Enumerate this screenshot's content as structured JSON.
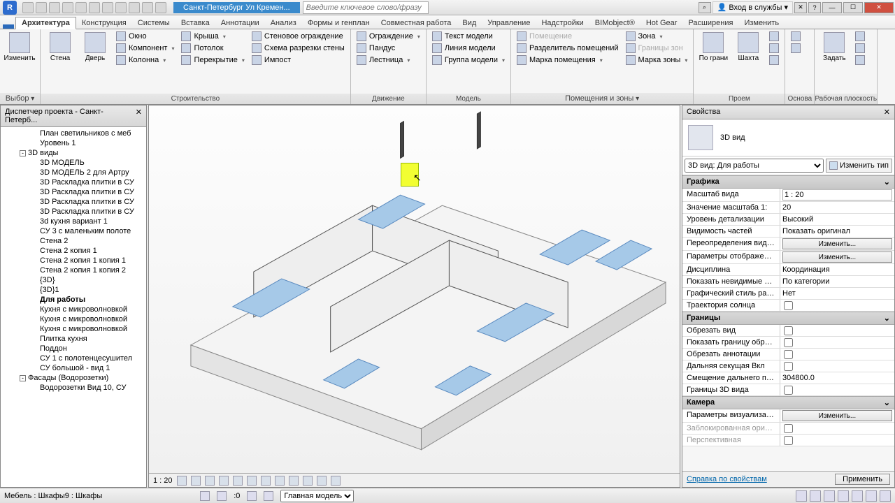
{
  "titlebar": {
    "app_initial": "R",
    "doc_title": "Санкт-Петербург Ул Кремен...",
    "search_placeholder": "Введите ключевое слово/фразу",
    "login_label": "Вход в службы",
    "star": "★"
  },
  "menutabs": {
    "file": "",
    "items": [
      "Архитектура",
      "Конструкция",
      "Системы",
      "Вставка",
      "Аннотации",
      "Анализ",
      "Формы и генплан",
      "Совместная работа",
      "Вид",
      "Управление",
      "Надстройки",
      "BIMobject®",
      "Hot Gear",
      "Расширения",
      "Изменить"
    ],
    "active_index": 0
  },
  "ribbon": {
    "select": {
      "modify": "Изменить",
      "title": "Выбор"
    },
    "build": {
      "wall": "Стена",
      "door": "Дверь",
      "window": "Окно",
      "component": "Компонент",
      "column": "Колонна",
      "roof": "Крыша",
      "ceiling": "Потолок",
      "floor": "Перекрытие",
      "curtain_wall": "Стеновое ограждение",
      "curtain_grid": "Схема разрезки стены",
      "mullion": "Импост",
      "title": "Строительство"
    },
    "circulation": {
      "railing": "Ограждение",
      "ramp": "Пандус",
      "stair": "Лестница",
      "title": "Движение"
    },
    "model": {
      "model_text": "Текст модели",
      "model_line": "Линия  модели",
      "model_group": "Группа модели",
      "title": "Модель"
    },
    "room": {
      "room": "Помещение",
      "room_sep": "Разделитель помещений",
      "room_tag": "Марка помещения",
      "area": "Зона",
      "area_bound": "Границы зон",
      "area_tag": "Марка зоны",
      "title": "Помещения и зоны"
    },
    "opening": {
      "by_face": "По грани",
      "shaft": "Шахта",
      "title": "Проем"
    },
    "datum": {
      "title": "Основа"
    },
    "workplane": {
      "set": "Задать",
      "title": "Рабочая плоскость"
    }
  },
  "project_browser": {
    "title": "Диспетчер проекта - Санкт-Петерб...",
    "items": [
      {
        "t": "План светильников с меб",
        "lvl": 2
      },
      {
        "t": "Уровень 1",
        "lvl": 2
      },
      {
        "t": "3D виды",
        "lvl": 1,
        "exp": "-"
      },
      {
        "t": "3D МОДЕЛЬ",
        "lvl": 2
      },
      {
        "t": "3D МОДЕЛЬ 2 для Артру",
        "lvl": 2
      },
      {
        "t": "3D Раскладка плитки в СУ",
        "lvl": 2
      },
      {
        "t": "3D Раскладка плитки в СУ",
        "lvl": 2
      },
      {
        "t": "3D Раскладка плитки в СУ",
        "lvl": 2
      },
      {
        "t": "3D Раскладка плитки в СУ",
        "lvl": 2
      },
      {
        "t": "3d кухня вариант 1",
        "lvl": 2
      },
      {
        "t": "СУ 3 с маленьким полоте",
        "lvl": 2
      },
      {
        "t": "Стена 2",
        "lvl": 2
      },
      {
        "t": "Стена 2 копия 1",
        "lvl": 2
      },
      {
        "t": "Стена 2 копия 1 копия 1",
        "lvl": 2
      },
      {
        "t": "Стена 2 копия 1 копия 2",
        "lvl": 2
      },
      {
        "t": "{3D}",
        "lvl": 2
      },
      {
        "t": "{3D}1",
        "lvl": 2
      },
      {
        "t": "Для работы",
        "lvl": 2,
        "bold": true
      },
      {
        "t": "Кухня с микроволновкой",
        "lvl": 2
      },
      {
        "t": "Кухня с микроволновкой",
        "lvl": 2
      },
      {
        "t": "Кухня с микроволновкой",
        "lvl": 2
      },
      {
        "t": "Плитка кухня",
        "lvl": 2
      },
      {
        "t": "Поддон",
        "lvl": 2
      },
      {
        "t": "СУ 1 с полотенцесушител",
        "lvl": 2
      },
      {
        "t": "СУ большой - вид 1",
        "lvl": 2
      },
      {
        "t": "Фасады (Водорозетки)",
        "lvl": 1,
        "exp": "-"
      },
      {
        "t": "Водорозетки Вид 10, СУ",
        "lvl": 2
      }
    ]
  },
  "viewport": {
    "scale": "1 : 20"
  },
  "properties": {
    "title": "Свойства",
    "type_name": "3D вид",
    "selector": "3D вид: Для работы",
    "edit_type": "Изменить тип",
    "groups": [
      {
        "name": "Графика",
        "rows": [
          {
            "k": "Масштаб вида",
            "v": "1 : 20",
            "input": true
          },
          {
            "k": "Значение масштаба  1:",
            "v": "20"
          },
          {
            "k": "Уровень детализации",
            "v": "Высокий"
          },
          {
            "k": "Видимость частей",
            "v": "Показать оригинал"
          },
          {
            "k": "Переопределения види...",
            "v": "Изменить...",
            "btn": true
          },
          {
            "k": "Параметры отображени...",
            "v": "Изменить...",
            "btn": true
          },
          {
            "k": "Дисциплина",
            "v": "Координация"
          },
          {
            "k": "Показать невидимые ли...",
            "v": "По категории"
          },
          {
            "k": "Графический стиль рас...",
            "v": "Нет"
          },
          {
            "k": "Траектория солнца",
            "v": "",
            "chk": true
          }
        ]
      },
      {
        "name": "Границы",
        "rows": [
          {
            "k": "Обрезать вид",
            "v": "",
            "chk": true
          },
          {
            "k": "Показать границу обрезки",
            "v": "",
            "chk": true
          },
          {
            "k": "Обрезать аннотации",
            "v": "",
            "chk": true
          },
          {
            "k": "Дальняя секущая Вкл",
            "v": "",
            "chk": true
          },
          {
            "k": "Смещение дальнего пре...",
            "v": "304800.0"
          },
          {
            "k": "Границы 3D вида",
            "v": "",
            "chk": true
          }
        ]
      },
      {
        "name": "Камера",
        "rows": [
          {
            "k": "Параметры визуализации",
            "v": "Изменить...",
            "btn": true
          },
          {
            "k": "Заблокированная ориен...",
            "v": "",
            "chk": true,
            "dis": true
          },
          {
            "k": "Перспективная",
            "v": "",
            "chk": true,
            "dis": true
          }
        ]
      }
    ],
    "help": "Справка по свойствам",
    "apply": "Применить"
  },
  "statusbar": {
    "selection": "Мебель : Шкафы9 : Шкафы",
    "zero": ":0",
    "model_select": "Главная модель"
  }
}
